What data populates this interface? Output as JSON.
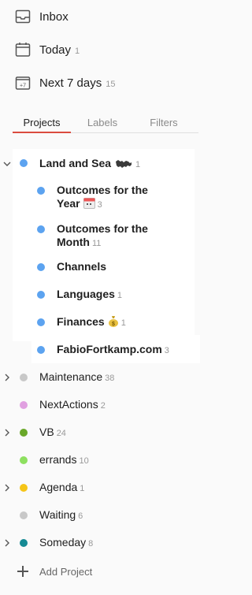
{
  "nav": {
    "inbox": {
      "label": "Inbox",
      "count": ""
    },
    "today": {
      "label": "Today",
      "count": "1"
    },
    "next7": {
      "label": "Next 7 days",
      "count": "15",
      "icon_text": "+7"
    }
  },
  "tabs": [
    "Projects",
    "Labels",
    "Filters"
  ],
  "projects": [
    {
      "label": "Land and Sea",
      "emoji": "world-map",
      "count": "1",
      "color": "#5ca3f0",
      "bold": true,
      "expanded": true
    },
    {
      "label": "Outcomes for the",
      "label2": "Year",
      "emoji": "calendar",
      "count": "3",
      "color": "#5ca3f0",
      "bold": true
    },
    {
      "label": "Outcomes for the",
      "label2": "Month",
      "count": "11",
      "color": "#5ca3f0",
      "bold": true
    },
    {
      "label": "Channels",
      "count": "",
      "color": "#5ca3f0",
      "bold": true
    },
    {
      "label": "Languages",
      "count": "1",
      "color": "#5ca3f0",
      "bold": true
    },
    {
      "label": "Finances",
      "emoji": "money-bag",
      "count": "1",
      "color": "#5ca3f0",
      "bold": true
    },
    {
      "label": "FabioFortkamp.com",
      "count": "3",
      "color": "#5ca3f0",
      "bold": true
    },
    {
      "label": "Maintenance",
      "count": "38",
      "color": "#c8c8c8",
      "collapsed": true
    },
    {
      "label": "NextActions",
      "count": "2",
      "color": "#e0a0e0"
    },
    {
      "label": "VB",
      "count": "24",
      "color": "#6aa82a",
      "collapsed": true
    },
    {
      "label": "errands",
      "count": "10",
      "color": "#8ee060"
    },
    {
      "label": "Agenda",
      "count": "1",
      "color": "#f5c518",
      "collapsed": true
    },
    {
      "label": "Waiting",
      "count": "6",
      "color": "#c8c8c8"
    },
    {
      "label": "Someday",
      "count": "8",
      "color": "#158a94",
      "collapsed": true
    }
  ],
  "add_project_label": "Add Project"
}
